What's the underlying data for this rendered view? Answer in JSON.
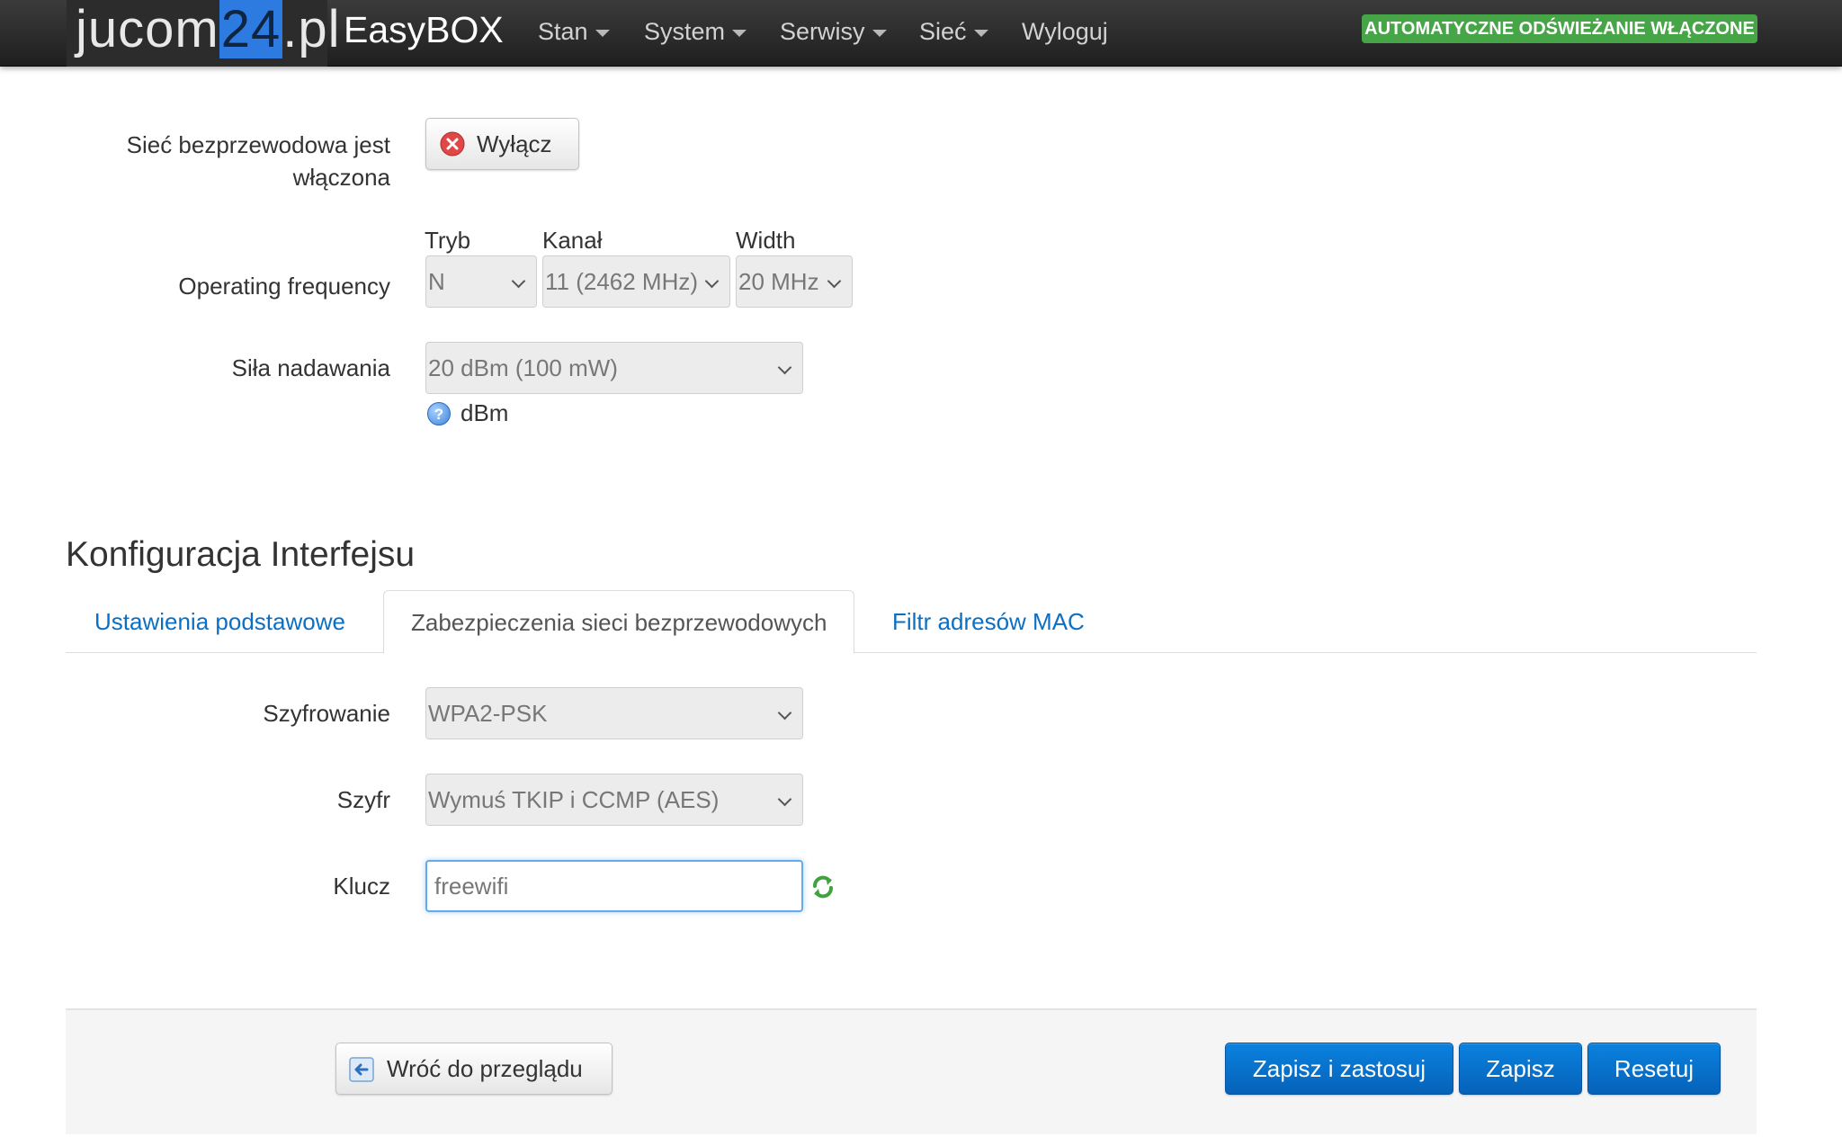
{
  "navbar": {
    "logo_pre": "jucom",
    "logo_highlight": "24",
    "logo_post": ".pl",
    "brand": "EasyBOX",
    "menu": [
      {
        "label": "Stan",
        "dropdown": true
      },
      {
        "label": "System",
        "dropdown": true
      },
      {
        "label": "Serwisy",
        "dropdown": true
      },
      {
        "label": "Sieć",
        "dropdown": true
      },
      {
        "label": "Wyloguj",
        "dropdown": false
      }
    ],
    "auto_refresh_badge": "AUTOMATYCZNE ODŚWIEŻANIE WŁĄCZONE",
    "auto_refresh_color": "#46a546"
  },
  "wireless": {
    "status_label": "Sieć bezprzewodowa jest włączona",
    "toggle_button": "Wyłącz",
    "toggle_icon": "close-circle-icon",
    "frequency": {
      "label": "Operating frequency",
      "mode": {
        "title": "Tryb",
        "value": "N"
      },
      "channel": {
        "title": "Kanał",
        "value": "11 (2462 MHz)"
      },
      "width": {
        "title": "Width",
        "value": "20 MHz"
      }
    },
    "tx_power": {
      "label": "Siła nadawania",
      "value": "20 dBm (100 mW)",
      "help_text": "dBm",
      "help_icon": "help-icon"
    }
  },
  "interface_config": {
    "title": "Konfiguracja Interfejsu",
    "tabs": [
      {
        "label": "Ustawienia podstawowe",
        "active": false
      },
      {
        "label": "Zabezpieczenia sieci bezprzewodowych",
        "active": true
      },
      {
        "label": "Filtr adresów MAC",
        "active": false
      }
    ],
    "encryption": {
      "label": "Szyfrowanie",
      "value": "WPA2-PSK"
    },
    "cipher": {
      "label": "Szyfr",
      "value": "Wymuś TKIP i CCMP (AES)"
    },
    "key": {
      "label": "Klucz",
      "value": "freewifi",
      "reveal_icon": "refresh-icon"
    }
  },
  "actions": {
    "back_button": "Wróć do przeglądu",
    "back_icon": "back-arrow-icon",
    "save_apply": "Zapisz i zastosuj",
    "save": "Zapisz",
    "reset": "Resetuj",
    "accent": "#0a74d0"
  }
}
